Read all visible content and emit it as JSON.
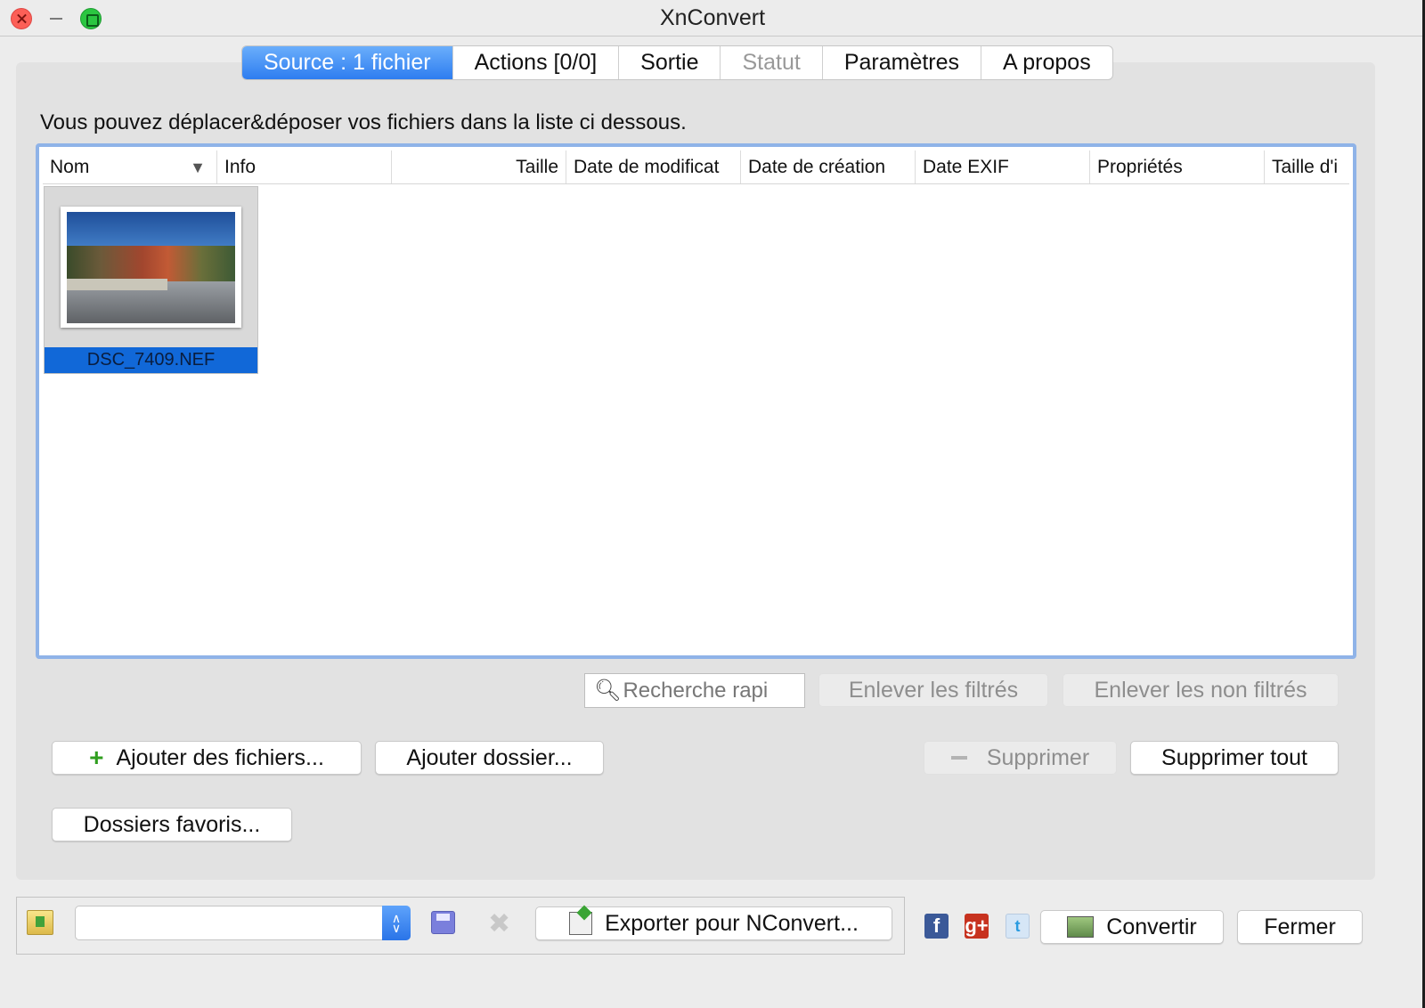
{
  "window": {
    "title": "XnConvert"
  },
  "tabs": [
    {
      "label": "Source : 1 fichier",
      "state": "active"
    },
    {
      "label": "Actions [0/0]",
      "state": "normal"
    },
    {
      "label": "Sortie",
      "state": "normal"
    },
    {
      "label": "Statut",
      "state": "disabled"
    },
    {
      "label": "Paramètres",
      "state": "normal"
    },
    {
      "label": "A propos",
      "state": "normal"
    }
  ],
  "source": {
    "hint": "Vous pouvez déplacer&déposer vos fichiers dans la liste ci dessous.",
    "columns": [
      "Nom",
      "Info",
      "Taille",
      "Date de modificat",
      "Date de création",
      "Date EXIF",
      "Propriétés",
      "Taille d'i"
    ],
    "sort_indicator": "▼",
    "files": [
      {
        "name": "DSC_7409.NEF",
        "selected": true
      }
    ],
    "search_placeholder": "Recherche rapi",
    "remove_filtered": "Enlever les filtrés",
    "remove_unfiltered": "Enlever les non filtrés",
    "add_files": "Ajouter des fichiers...",
    "add_folder": "Ajouter dossier...",
    "remove": "Supprimer",
    "remove_all": "Supprimer tout",
    "favorite_folders": "Dossiers favoris..."
  },
  "footer": {
    "preset_value": "",
    "export_nconvert": "Exporter pour NConvert...",
    "convert": "Convertir",
    "close": "Fermer",
    "icons": {
      "facebook": "f",
      "google_plus": "g+",
      "twitter": "t"
    }
  }
}
